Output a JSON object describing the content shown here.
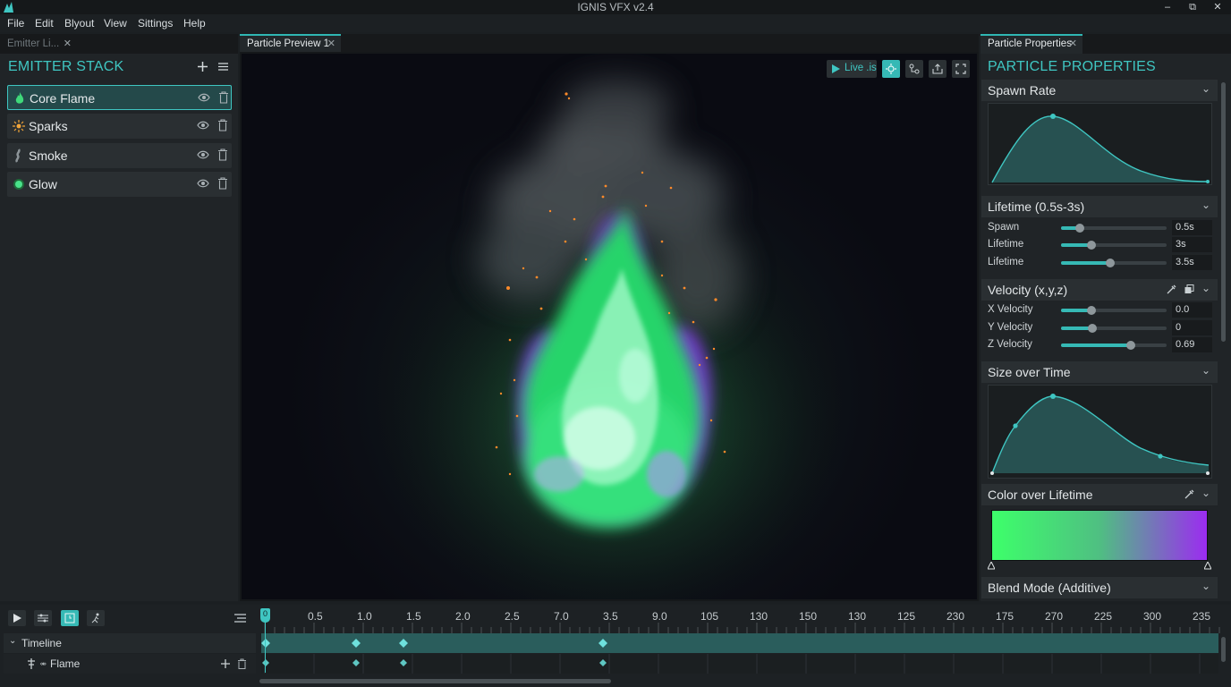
{
  "window": {
    "title": "IGNIS VFX v2.4"
  },
  "menu": [
    "File",
    "Edit",
    "Blyout",
    "View",
    "Sittings",
    "Help"
  ],
  "left_panel": {
    "tab_label": "Emitter Li...",
    "title": "EMITTER STACK",
    "add_icon": "plus-icon",
    "menu_icon": "hamburger-icon",
    "emitters": [
      {
        "label": "Core Flame",
        "icon": "flame-icon",
        "selected": true
      },
      {
        "label": "Sparks",
        "icon": "sparks-icon",
        "selected": false
      },
      {
        "label": "Smoke",
        "icon": "smoke-icon",
        "selected": false
      },
      {
        "label": "Glow",
        "icon": "glow-icon",
        "selected": false
      }
    ]
  },
  "preview": {
    "tab_label": "Particle Preview 1",
    "live_label": "Live .is",
    "toolbar_icons": [
      "particles-icon",
      "nodes-icon",
      "export-icon",
      "fullscreen-icon"
    ]
  },
  "properties": {
    "tab_label": "Particle Properties",
    "title": "PARTICLE PROPERTIES",
    "spawn_rate": {
      "title": "Spawn Rate"
    },
    "lifetime": {
      "title": "Lifetime (0.5s-3s)",
      "rows": [
        {
          "label": "Spawn",
          "value": "0.5s",
          "level": 0.18
        },
        {
          "label": "Lifetime",
          "value": "3s",
          "level": 0.29
        },
        {
          "label": "Lifetime",
          "value": "3.5s",
          "level": 0.47
        }
      ]
    },
    "velocity": {
      "title": "Velocity (x,y,z)",
      "rows": [
        {
          "label": "X Velocity",
          "value": "0.0",
          "level": 0.29
        },
        {
          "label": "Y Velocity",
          "value": "0",
          "level": 0.3
        },
        {
          "label": "Z Velocity",
          "value": "0.69",
          "level": 0.66
        }
      ]
    },
    "size_over_time": {
      "title": "Size over Time"
    },
    "color_over_lifetime": {
      "title": "Color over Lifetime",
      "start_color": "#3dff6a",
      "end_color": "#9b2cf0"
    },
    "blend_mode": {
      "title": "Blend Mode (Additive)"
    }
  },
  "timeline": {
    "playhead_label": "0",
    "ticks": [
      "0.5",
      "1.0",
      "1.5",
      "2.0",
      "2.5",
      "7.0",
      "3.5",
      "9.0",
      "105",
      "130",
      "150",
      "130",
      "125",
      "230",
      "175",
      "270",
      "225",
      "300",
      "235"
    ],
    "tracks": [
      {
        "label": "Timeline"
      },
      {
        "label": "Flame"
      }
    ]
  },
  "colors": {
    "accent": "#3fc6c2",
    "panel": "#202427",
    "selected": "#24494a"
  }
}
